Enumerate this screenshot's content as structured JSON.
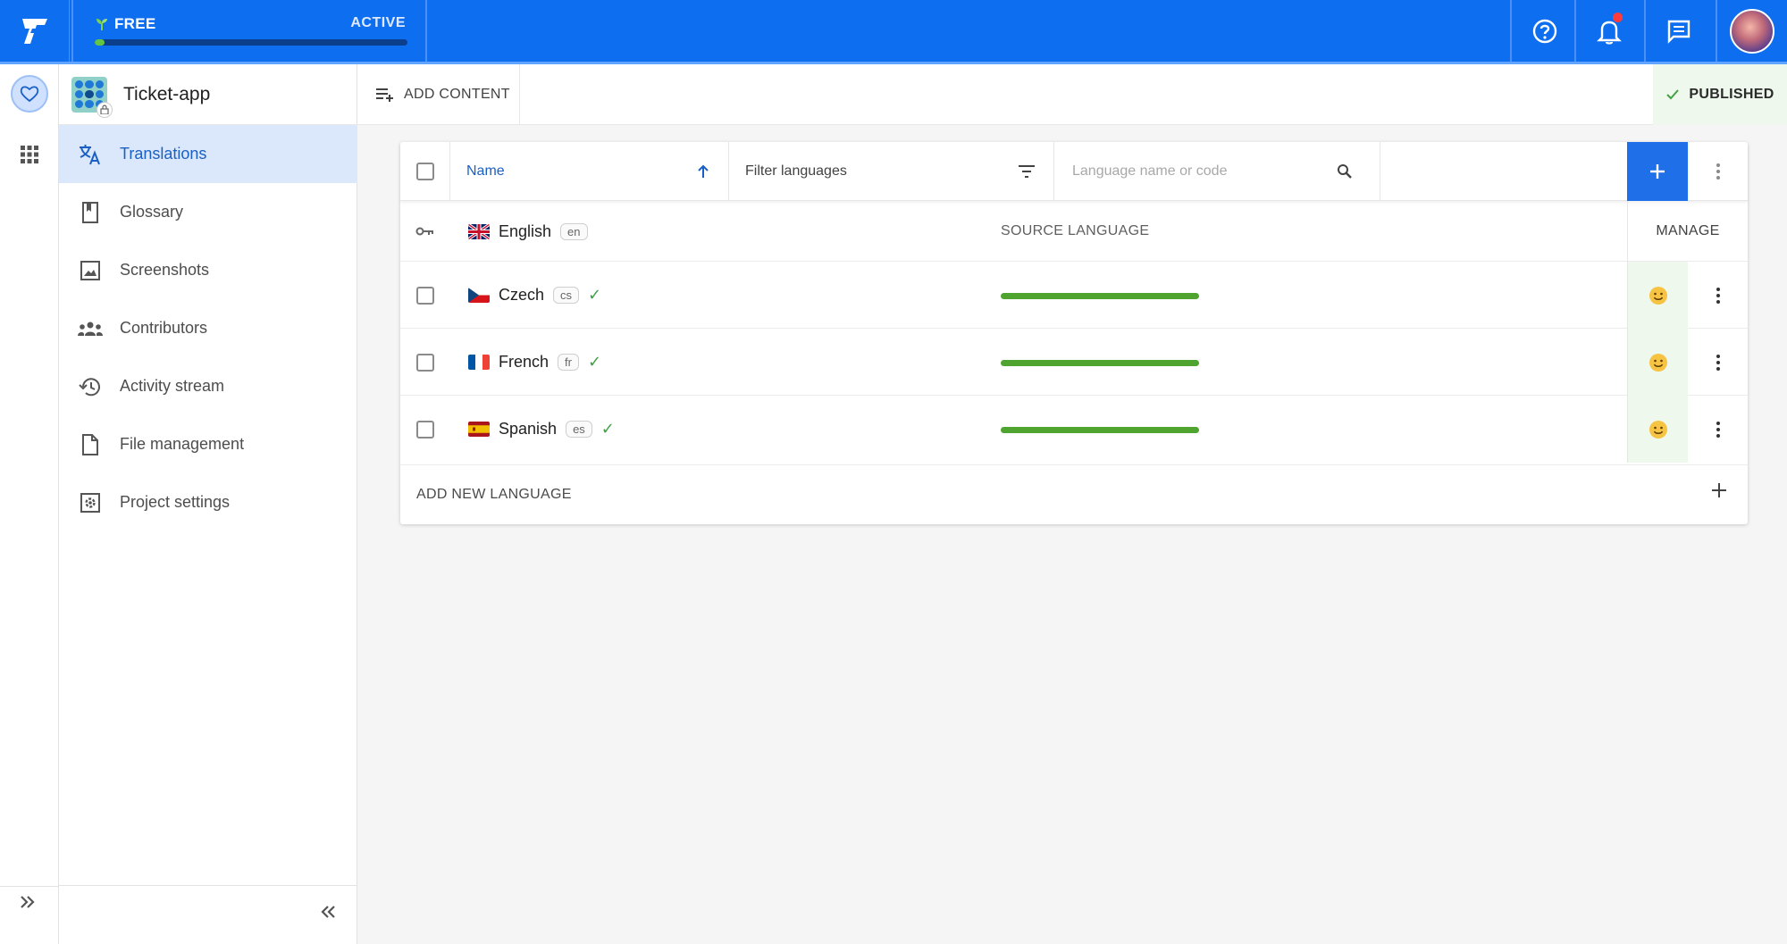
{
  "topbar": {
    "plan_label": "FREE",
    "plan_status": "ACTIVE",
    "plan_progress": 0.03,
    "colors": {
      "bar": "#0d6ff0",
      "progress": "#62c544"
    }
  },
  "project": {
    "name": "Ticket-app"
  },
  "sidebar": {
    "items": [
      {
        "label": "Translations",
        "icon": "translate-icon",
        "active": true
      },
      {
        "label": "Glossary",
        "icon": "book-icon",
        "active": false
      },
      {
        "label": "Screenshots",
        "icon": "image-icon",
        "active": false
      },
      {
        "label": "Contributors",
        "icon": "people-icon",
        "active": false
      },
      {
        "label": "Activity stream",
        "icon": "history-icon",
        "active": false
      },
      {
        "label": "File management",
        "icon": "file-icon",
        "active": false
      },
      {
        "label": "Project settings",
        "icon": "settings-icon",
        "active": false
      }
    ]
  },
  "toolbar": {
    "add_content": "ADD CONTENT",
    "published": "PUBLISHED"
  },
  "table": {
    "header": {
      "name": "Name",
      "filter": "Filter languages",
      "search_placeholder": "Language name or code"
    },
    "source": {
      "name": "English",
      "code": "en",
      "label": "SOURCE LANGUAGE",
      "manage": "MANAGE"
    },
    "languages": [
      {
        "name": "Czech",
        "code": "cs",
        "progress": 1.0
      },
      {
        "name": "French",
        "code": "fr",
        "progress": 1.0
      },
      {
        "name": "Spanish",
        "code": "es",
        "progress": 1.0
      }
    ],
    "add_new_language": "ADD NEW LANGUAGE"
  }
}
